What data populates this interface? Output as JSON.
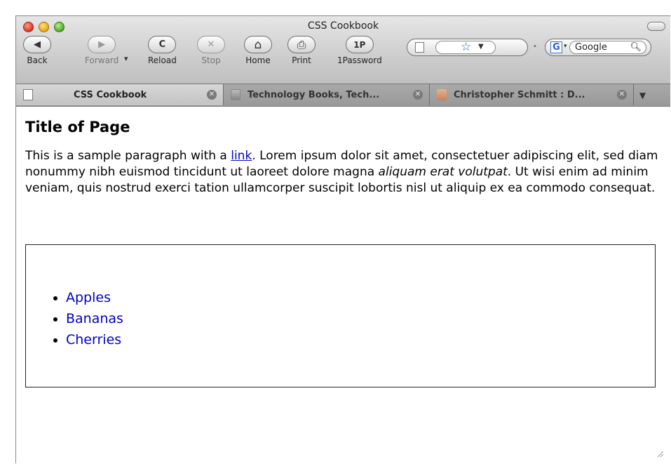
{
  "window": {
    "title": "CSS Cookbook"
  },
  "toolbar": {
    "buttons": [
      {
        "id": "back",
        "label": "Back",
        "icon": "back-arrow-icon",
        "glyph": "◀",
        "disabled": false
      },
      {
        "id": "forward",
        "label": "Forward",
        "icon": "forward-arrow-icon",
        "glyph": "▶",
        "disabled": true
      },
      {
        "id": "reload",
        "label": "Reload",
        "icon": "reload-icon",
        "glyph": "C",
        "disabled": false
      },
      {
        "id": "stop",
        "label": "Stop",
        "icon": "stop-icon",
        "glyph": "✕",
        "disabled": true
      },
      {
        "id": "home",
        "label": "Home",
        "icon": "home-icon",
        "glyph": "⌂",
        "disabled": false
      },
      {
        "id": "print",
        "label": "Print",
        "icon": "printer-icon",
        "glyph": "⎙",
        "disabled": false
      },
      {
        "id": "onepassword",
        "label": "1Password",
        "icon": "1password-icon",
        "glyph": "1P",
        "disabled": false
      }
    ],
    "search_placeholder": "Google",
    "search_engine_letter": "G"
  },
  "tabs": [
    {
      "title": "CSS Cookbook",
      "active": true,
      "favicon": "page-icon"
    },
    {
      "title": "Technology Books, Tech...",
      "active": false,
      "favicon": "books-icon"
    },
    {
      "title": "Christopher Schmitt : D...",
      "active": false,
      "favicon": "photo-icon"
    }
  ],
  "page": {
    "heading": "Title of Page",
    "para_before_link": "This is a sample paragraph with a ",
    "link_text": "link",
    "para_after_link": ". Lorem ipsum dolor sit amet, consectetuer adipiscing elit, sed diam nonummy nibh euismod tincidunt ut laoreet dolore magna ",
    "para_emphasis": "aliquam erat volutpat",
    "para_end": ". Ut wisi enim ad minim veniam, quis nostrud exerci tation ullamcorper suscipit lobortis nisl ut aliquip ex ea commodo consequat.",
    "list_items": [
      "Apples",
      "Bananas",
      "Cherries"
    ]
  },
  "colors": {
    "link": "#0000cc",
    "list_link": "#0000c8"
  }
}
